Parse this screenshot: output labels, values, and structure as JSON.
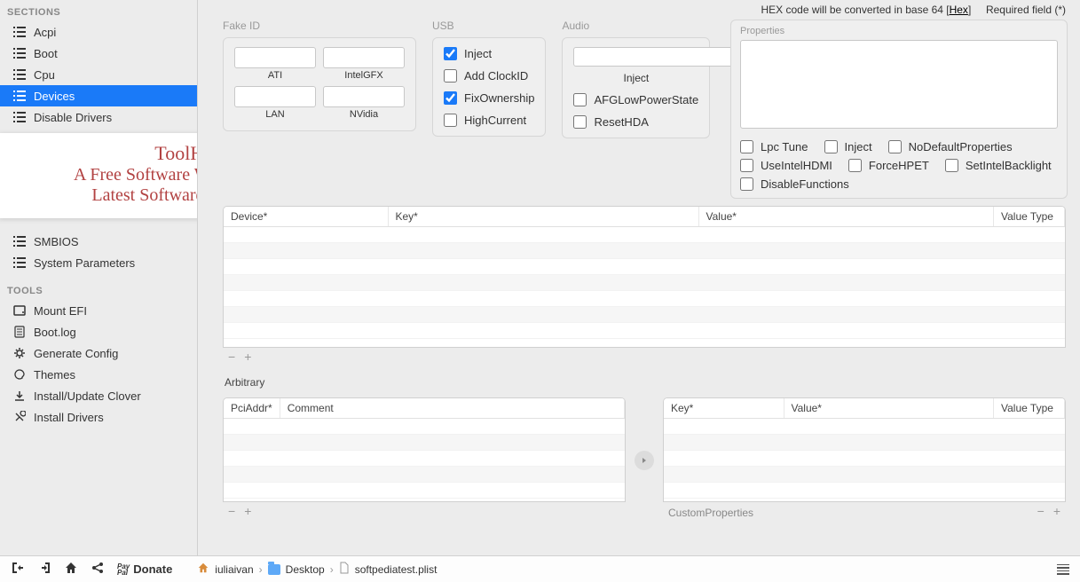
{
  "sidebar": {
    "sectionsHeader": "SECTIONS",
    "toolsHeader": "TOOLS",
    "sections": [
      {
        "label": "Acpi"
      },
      {
        "label": "Boot"
      },
      {
        "label": "Cpu"
      },
      {
        "label": "Devices"
      },
      {
        "label": "Disable Drivers"
      },
      {
        "label": "SMBIOS"
      },
      {
        "label": "System Parameters"
      }
    ],
    "tools": [
      {
        "label": "Mount EFI"
      },
      {
        "label": "Boot.log"
      },
      {
        "label": "Generate Config"
      },
      {
        "label": "Themes"
      },
      {
        "label": "Install/Update Clover"
      },
      {
        "label": "Install Drivers"
      }
    ]
  },
  "watermark": {
    "line1": "ToolHip.com",
    "line2": "A Free Software World To Download",
    "line3": "Latest Software, Apps & Gmaes"
  },
  "header": {
    "hexText": "HEX code will be converted in base 64 [",
    "hexLink": "Hex",
    "hexClose": "]",
    "required": "Required field (*)"
  },
  "fakeId": {
    "title": "Fake ID",
    "labels": {
      "ati": "ATI",
      "intelgfx": "IntelGFX",
      "lan": "LAN",
      "nvidia": "NVidia"
    },
    "values": {
      "ati": "",
      "intelgfx": "",
      "lan": "",
      "nvidia": ""
    }
  },
  "usb": {
    "title": "USB",
    "inject": {
      "label": "Inject",
      "checked": true
    },
    "addClock": {
      "label": "Add ClockID",
      "checked": false
    },
    "fixOwn": {
      "label": "FixOwnership",
      "checked": true
    },
    "highCurrent": {
      "label": "HighCurrent",
      "checked": false
    }
  },
  "audio": {
    "title": "Audio",
    "value": "",
    "injectLabel": "Inject",
    "afg": {
      "label": "AFGLowPowerState",
      "checked": false
    },
    "reset": {
      "label": "ResetHDA",
      "checked": false
    }
  },
  "properties": {
    "title": "Properties",
    "value": "",
    "checks": {
      "lpcTune": {
        "label": "Lpc Tune",
        "checked": false
      },
      "inject": {
        "label": "Inject",
        "checked": false
      },
      "noDefault": {
        "label": "NoDefaultProperties",
        "checked": false
      },
      "useIntelHDMI": {
        "label": "UseIntelHDMI",
        "checked": false
      },
      "forceHPET": {
        "label": "ForceHPET",
        "checked": false
      },
      "setIntelBacklight": {
        "label": "SetIntelBacklight",
        "checked": false
      },
      "disableFunctions": {
        "label": "DisableFunctions",
        "checked": false
      }
    }
  },
  "mainTable": {
    "headers": {
      "device": "Device*",
      "key": "Key*",
      "value": "Value*",
      "valueType": "Value Type"
    }
  },
  "arbitrary": {
    "title": "Arbitrary",
    "left": {
      "headers": {
        "pciAddr": "PciAddr*",
        "comment": "Comment"
      }
    },
    "right": {
      "headers": {
        "key": "Key*",
        "value": "Value*",
        "valueType": "Value Type"
      }
    },
    "customProps": "CustomProperties"
  },
  "statusbar": {
    "donate": "Donate",
    "paypal1": "Pay",
    "paypal2": "Pal",
    "crumb": {
      "user": "iuliaivan",
      "folder": "Desktop",
      "file": "softpediatest.plist"
    }
  }
}
